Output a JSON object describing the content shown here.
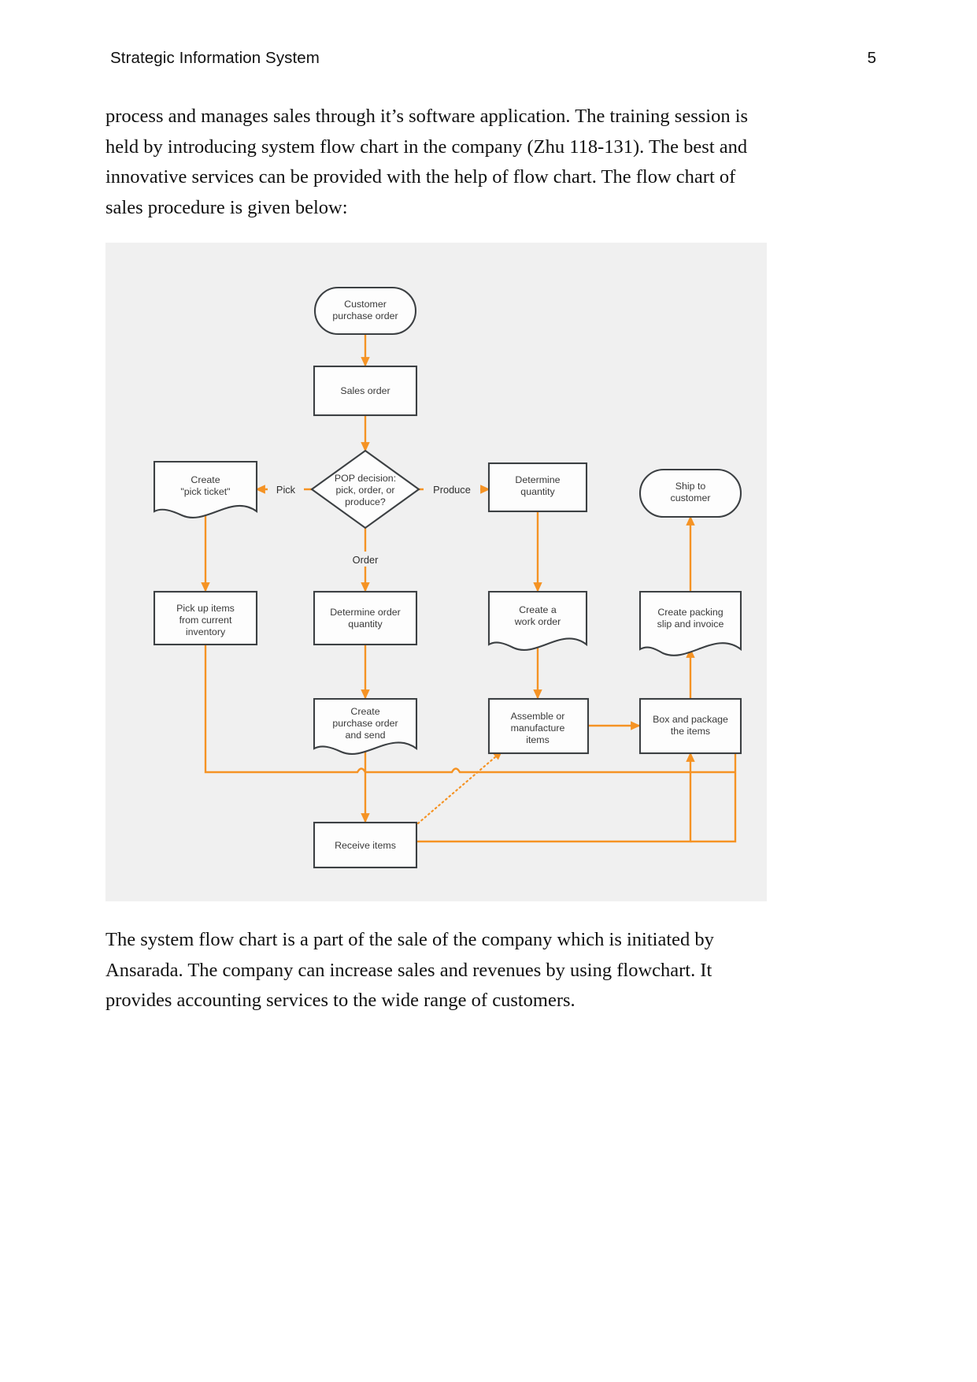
{
  "header": {
    "title": "Strategic Information System",
    "page_number": "5"
  },
  "body": {
    "paragraph_top": "process and manages sales through it’s software application. The training session is held by introducing system flow chart in the company (Zhu 118-131). The best and innovative services can be provided with the help of flow chart. The flow chart of sales procedure is given below:",
    "paragraph_bottom": "The system flow chart is a part of the sale of the company which is initiated by Ansarada. The company can increase sales and revenues by using flowchart. It provides accounting services to the wide range of customers."
  },
  "figure": {
    "background_color": "#f0f0f0",
    "line_color": "#f59324",
    "shape_stroke_color": "#3c4043",
    "shape_fill_color": "#fdfdfd",
    "nodes": {
      "customer_purchase_order": {
        "line1": "Customer",
        "line2": "purchase order",
        "shape": "terminator"
      },
      "sales_order": {
        "line1": "Sales order",
        "shape": "process"
      },
      "pop_decision": {
        "line1": "POP decision:",
        "line2": "pick, order, or",
        "line3": "produce?",
        "shape": "decision"
      },
      "create_pick_ticket": {
        "line1": "Create",
        "line2": "\"pick ticket\"",
        "shape": "document"
      },
      "determine_quantity": {
        "line1": "Determine",
        "line2": "quantity",
        "shape": "process"
      },
      "ship_to_customer": {
        "line1": "Ship to",
        "line2": "customer",
        "shape": "terminator"
      },
      "pick_up_items": {
        "line1": "Pick up items",
        "line2": "from current",
        "line3": "inventory",
        "shape": "process"
      },
      "determine_order_quantity": {
        "line1": "Determine order",
        "line2": "quantity",
        "shape": "process"
      },
      "create_work_order": {
        "line1": "Create a",
        "line2": "work order",
        "shape": "document"
      },
      "create_packing_slip": {
        "line1": "Create packing",
        "line2": "slip and invoice",
        "shape": "document"
      },
      "create_purchase_order": {
        "line1": "Create",
        "line2": "purchase order",
        "line3": "and send",
        "shape": "document"
      },
      "assemble_items": {
        "line1": "Assemble or",
        "line2": "manufacture",
        "line3": "items",
        "shape": "process"
      },
      "box_and_package": {
        "line1": "Box and package",
        "line2": "the items",
        "shape": "process"
      },
      "receive_items": {
        "line1": "Receive items",
        "shape": "process"
      }
    },
    "edge_labels": {
      "pick": "Pick",
      "produce": "Produce",
      "order": "Order"
    }
  }
}
